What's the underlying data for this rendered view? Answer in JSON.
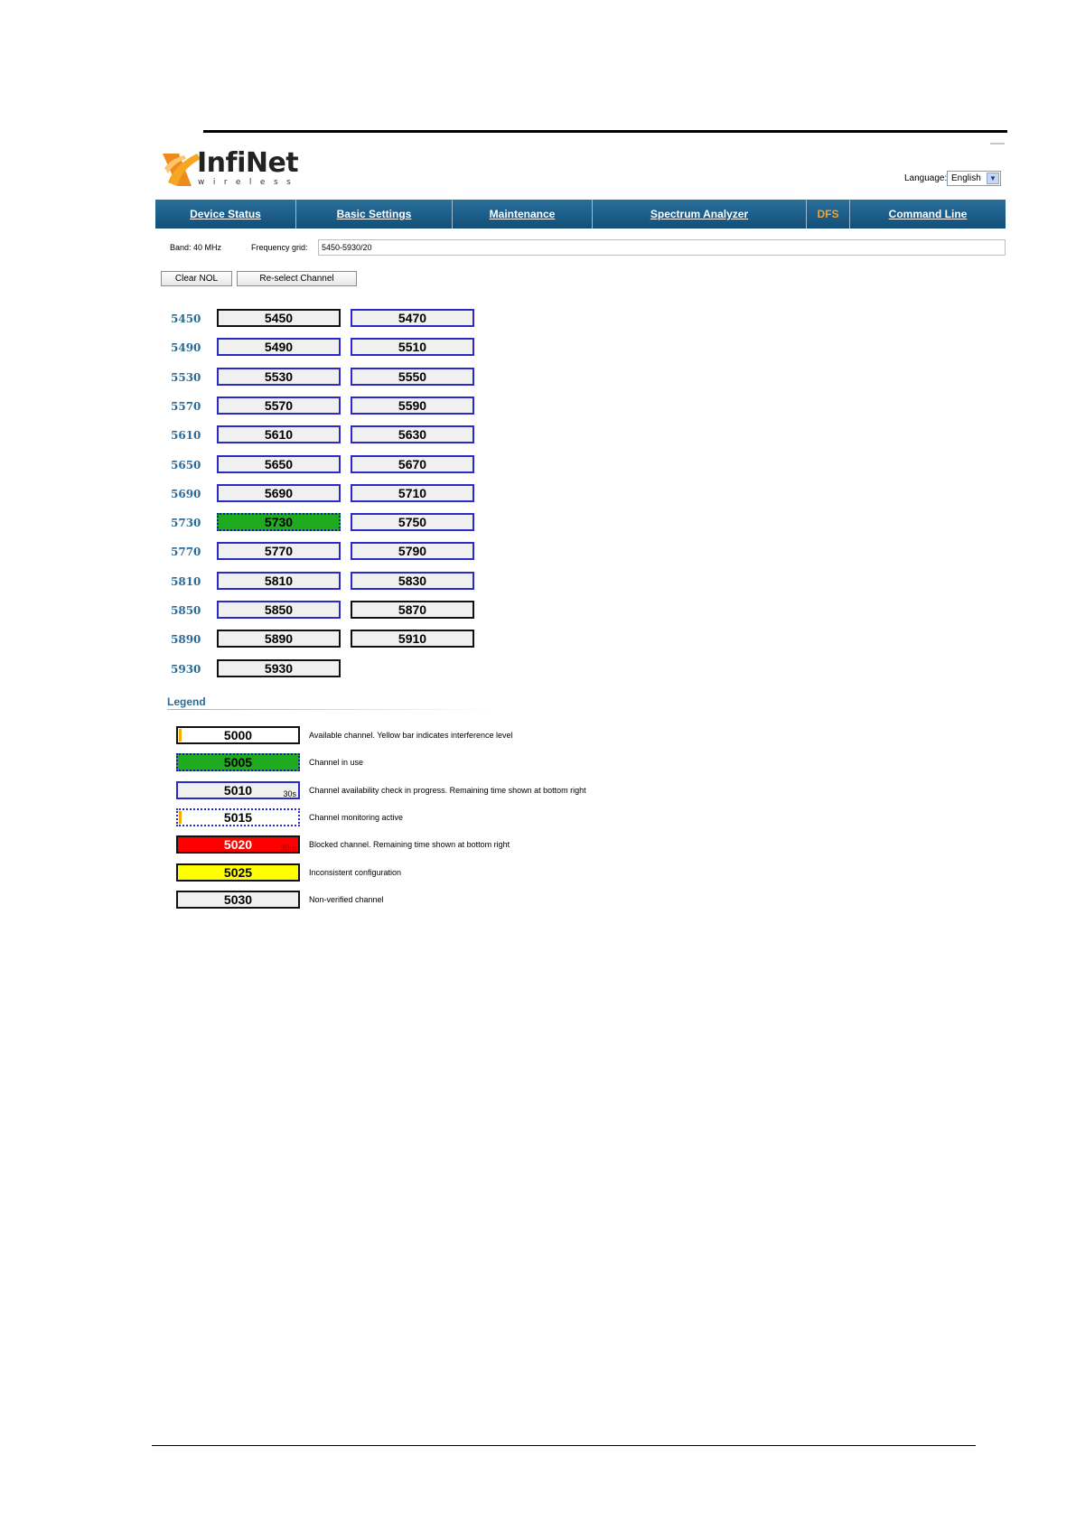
{
  "branding": {
    "logo_text": "InfiNet",
    "logo_sub": "wireless"
  },
  "language": {
    "label": "Language:",
    "selected": "English"
  },
  "nav": {
    "items": [
      {
        "label": "Device Status",
        "w": 156
      },
      {
        "label": "Basic Settings",
        "w": 173
      },
      {
        "label": "Maintenance",
        "w": 155
      },
      {
        "label": "Spectrum Analyzer",
        "w": 237
      },
      {
        "label": "DFS",
        "w": 48,
        "active": true
      },
      {
        "label": "Command Line",
        "w": 172
      }
    ]
  },
  "info": {
    "band_label": "Band:  40 MHz",
    "grid_label": "Frequency grid:",
    "grid_value": "5450-5930/20"
  },
  "buttons": {
    "clear_nol": "Clear NOL",
    "reselect": "Re-select Channel"
  },
  "channels": {
    "rows": [
      {
        "label": "5450",
        "cells": [
          {
            "freq": "5450",
            "state": "nonver"
          },
          {
            "freq": "5470",
            "state": "cac"
          }
        ]
      },
      {
        "label": "5490",
        "cells": [
          {
            "freq": "5490",
            "state": "cac"
          },
          {
            "freq": "5510",
            "state": "cac"
          }
        ]
      },
      {
        "label": "5530",
        "cells": [
          {
            "freq": "5530",
            "state": "cac"
          },
          {
            "freq": "5550",
            "state": "cac"
          }
        ]
      },
      {
        "label": "5570",
        "cells": [
          {
            "freq": "5570",
            "state": "cac"
          },
          {
            "freq": "5590",
            "state": "cac"
          }
        ]
      },
      {
        "label": "5610",
        "cells": [
          {
            "freq": "5610",
            "state": "cac"
          },
          {
            "freq": "5630",
            "state": "cac"
          }
        ]
      },
      {
        "label": "5650",
        "cells": [
          {
            "freq": "5650",
            "state": "cac"
          },
          {
            "freq": "5670",
            "state": "cac"
          }
        ]
      },
      {
        "label": "5690",
        "cells": [
          {
            "freq": "5690",
            "state": "cac"
          },
          {
            "freq": "5710",
            "state": "cac"
          }
        ]
      },
      {
        "label": "5730",
        "cells": [
          {
            "freq": "5730",
            "state": "inuse"
          },
          {
            "freq": "5750",
            "state": "cac"
          }
        ]
      },
      {
        "label": "5770",
        "cells": [
          {
            "freq": "5770",
            "state": "cac"
          },
          {
            "freq": "5790",
            "state": "cac"
          }
        ]
      },
      {
        "label": "5810",
        "cells": [
          {
            "freq": "5810",
            "state": "cac"
          },
          {
            "freq": "5830",
            "state": "cac"
          }
        ]
      },
      {
        "label": "5850",
        "cells": [
          {
            "freq": "5850",
            "state": "cac"
          },
          {
            "freq": "5870",
            "state": "nonver"
          }
        ]
      },
      {
        "label": "5890",
        "cells": [
          {
            "freq": "5890",
            "state": "nonver"
          },
          {
            "freq": "5910",
            "state": "nonver"
          }
        ]
      },
      {
        "label": "5930",
        "cells": [
          {
            "freq": "5930",
            "state": "nonver"
          }
        ]
      }
    ]
  },
  "legend": {
    "title": "Legend",
    "items": [
      {
        "freq": "5000",
        "state": "avail",
        "ybar": true,
        "desc": "Available channel. Yellow bar indicates interference level"
      },
      {
        "freq": "5005",
        "state": "inuse",
        "desc": "Channel in use"
      },
      {
        "freq": "5010",
        "state": "cac",
        "timer": "30s",
        "desc": "Channel availability check in progress. Remaining time shown at bottom right"
      },
      {
        "freq": "5015",
        "state": "monitor",
        "ybar": true,
        "desc": "Channel monitoring active"
      },
      {
        "freq": "5020",
        "state": "blocked",
        "timer": "30m",
        "desc": "Blocked channel. Remaining time shown at bottom right"
      },
      {
        "freq": "5025",
        "state": "incons",
        "desc": "Inconsistent configuration"
      },
      {
        "freq": "5030",
        "state": "nonver",
        "desc": "Non-verified channel"
      }
    ]
  },
  "colors": {
    "nav_bg": "#1a5f8c",
    "nav_active": "#f0a23a",
    "label_blue": "#2c6a96",
    "in_use": "#1faa1f",
    "blocked": "#ff0000",
    "inconsistent": "#ffff00",
    "cac_border": "#2a2acb"
  }
}
